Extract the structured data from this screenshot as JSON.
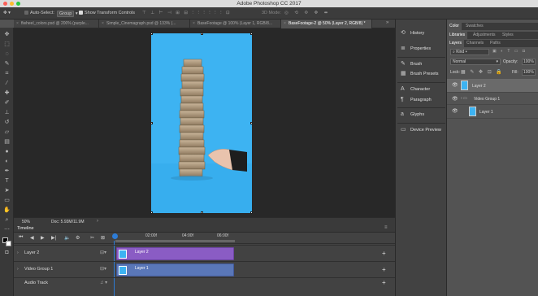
{
  "app": {
    "title": "Adobe Photoshop CC 2017"
  },
  "options_bar": {
    "auto_select_label": "Auto-Select:",
    "auto_select_value": "Group",
    "show_transform_label": "Show Transform Controls",
    "mode_label": "3D Mode:"
  },
  "document_tabs": [
    {
      "label": "flwheel_colors.psd @ 200% (purple..."
    },
    {
      "label": "Simple_Cinemagraph.psd @ 133% (..."
    },
    {
      "label": "BaseFootage @ 100% (Layer 1, RGB/8..."
    },
    {
      "label": "BaseFootage-2 @ 50% (Layer 2, RGB/8) *"
    }
  ],
  "status": {
    "zoom": "50%",
    "doc": "Doc: 5.93M/11.9M"
  },
  "timeline": {
    "title": "Timeline",
    "time_marks": [
      "02:00f",
      "04:00f",
      "06:00f"
    ],
    "tracks": [
      {
        "name": "Layer 2",
        "clip": "Layer 2"
      },
      {
        "name": "Video Group 1",
        "clip": "Layer 1"
      },
      {
        "name": "Audio Track"
      }
    ]
  },
  "side_panels": [
    {
      "label": "History",
      "icon": "history-icon"
    },
    {
      "label": "Properties",
      "icon": "properties-icon"
    },
    {
      "label": "Brush",
      "icon": "brush-icon"
    },
    {
      "label": "Brush Presets",
      "icon": "brush-presets-icon"
    },
    {
      "label": "Character",
      "icon": "character-icon"
    },
    {
      "label": "Paragraph",
      "icon": "paragraph-icon"
    },
    {
      "label": "Glyphs",
      "icon": "glyphs-icon"
    },
    {
      "label": "Device Preview",
      "icon": "device-preview-icon"
    }
  ],
  "right_panel": {
    "color_tabs": [
      "Color",
      "Swatches"
    ],
    "lib_tabs": [
      "Libraries",
      "Adjustments",
      "Styles"
    ],
    "layer_tabs": [
      "Layers",
      "Channels",
      "Paths"
    ],
    "kind_label": "Kind",
    "blend_mode": "Normal",
    "opacity_label": "Opacity:",
    "opacity_value": "100%",
    "lock_label": "Lock:",
    "fill_label": "Fill:",
    "fill_value": "100%",
    "layers": [
      {
        "name": "Layer 2"
      },
      {
        "name": "Video Group 1"
      },
      {
        "name": "Layer 1"
      }
    ]
  },
  "colors": {
    "photo_bg": "#3db3f2",
    "clip_purple": "#8a5cc4",
    "clip_blue": "#5a77b8",
    "accent": "#2d7cd6"
  }
}
